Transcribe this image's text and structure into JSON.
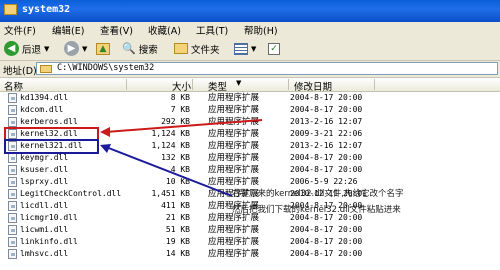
{
  "window": {
    "title": "system32"
  },
  "menu": [
    "文件(F)",
    "编辑(E)",
    "查看(V)",
    "收藏(A)",
    "工具(T)",
    "帮助(H)"
  ],
  "toolbar": {
    "back": "后退",
    "search": "搜索",
    "folders": "文件夹"
  },
  "address": {
    "label": "地址(D)",
    "path": "C:\\WINDOWS\\system32"
  },
  "columns": {
    "name": "名称",
    "size": "大小",
    "type": "类型",
    "modified": "修改日期"
  },
  "files": [
    {
      "name": "kd1394.dll",
      "size": "8 KB",
      "type": "应用程序扩展",
      "modified": "2004-8-17 20:00"
    },
    {
      "name": "kdcom.dll",
      "size": "7 KB",
      "type": "应用程序扩展",
      "modified": "2004-8-17 20:00"
    },
    {
      "name": "kerberos.dll",
      "size": "292 KB",
      "type": "应用程序扩展",
      "modified": "2013-2-16 12:07"
    },
    {
      "name": "kernel32.dll",
      "size": "1,124 KB",
      "type": "应用程序扩展",
      "modified": "2009-3-21 22:06"
    },
    {
      "name": "kernel321.dll",
      "size": "1,124 KB",
      "type": "应用程序扩展",
      "modified": "2013-2-16 12:07"
    },
    {
      "name": "keymgr.dll",
      "size": "132 KB",
      "type": "应用程序扩展",
      "modified": "2004-8-17 20:00"
    },
    {
      "name": "ksuser.dll",
      "size": "4 KB",
      "type": "应用程序扩展",
      "modified": "2004-8-17 20:00"
    },
    {
      "name": "lsprxy.dll",
      "size": "10 KB",
      "type": "应用程序扩展",
      "modified": "2006-5-9 22:26"
    },
    {
      "name": "LegitCheckControl.dll",
      "size": "1,451 KB",
      "type": "应用程序扩展",
      "modified": "2010-12-11 20:01"
    },
    {
      "name": "licdll.dll",
      "size": "411 KB",
      "type": "应用程序扩展",
      "modified": "2004-8-17 20:00"
    },
    {
      "name": "licmgr10.dll",
      "size": "21 KB",
      "type": "应用程序扩展",
      "modified": "2004-8-17 20:00"
    },
    {
      "name": "licwmi.dll",
      "size": "51 KB",
      "type": "应用程序扩展",
      "modified": "2004-8-17 20:00"
    },
    {
      "name": "linkinfo.dll",
      "size": "19 KB",
      "type": "应用程序扩展",
      "modified": "2004-8-17 20:00"
    },
    {
      "name": "lmhsvc.dll",
      "size": "14 KB",
      "type": "应用程序扩展",
      "modified": "2004-8-17 20:00"
    }
  ],
  "annotation": {
    "line1": "右键原来的kernel32.dll文件,先给它改个名字",
    "line2": "然后把我们下载的kernel32.dll文件粘贴进来"
  },
  "highlight_colors": {
    "red": "#cc1a1a",
    "blue": "#1a1a9a"
  }
}
